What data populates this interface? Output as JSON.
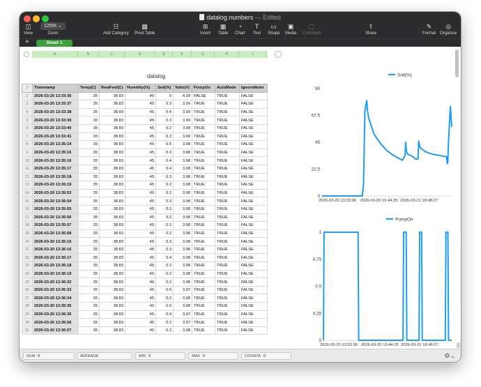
{
  "window": {
    "doc_name": "datalog.numbers",
    "doc_status": "— Edited"
  },
  "toolbar": {
    "view": "View",
    "zoom_value": "125%",
    "zoom": "Zoom",
    "add_category": "Add Category",
    "pivot_table": "Pivot Table",
    "insert": "Insert",
    "table": "Table",
    "chart": "Chart",
    "text": "Text",
    "shape": "Shape",
    "media": "Media",
    "comment": "Comment",
    "share": "Share",
    "format": "Format",
    "organise": "Organise"
  },
  "sheet_tab": "Sheet 1",
  "columns": [
    "A",
    "B",
    "C",
    "D",
    "E",
    "F",
    "G",
    "H",
    "I"
  ],
  "table": {
    "title": "datalog",
    "headers": [
      "Timestamp",
      "Temp(C)",
      "RealFeel(C)",
      "Humidity(%)",
      "Soil(%)",
      "Volts(V)",
      "PumpOn",
      "AutoMode",
      "IgnoreMoist"
    ],
    "header_row_number": "1",
    "rows": [
      [
        "2",
        "2026-03-20 13:33:36",
        "35",
        "38.83",
        "45",
        "0",
        "4.09",
        "FALSE",
        "TRUE",
        "FALSE"
      ],
      [
        "3",
        "2026-03-20 13:33:37",
        "35",
        "38.83",
        "45",
        "0.3",
        "3.99",
        "TRUE",
        "TRUE",
        "FALSE"
      ],
      [
        "4",
        "2026-03-20 13:33:38",
        "35",
        "38.83",
        "45",
        "0.4",
        "3.99",
        "TRUE",
        "TRUE",
        "FALSE"
      ],
      [
        "5",
        "2026-03-20 13:33:39",
        "35",
        "38.83",
        "45",
        "0.3",
        "3.99",
        "TRUE",
        "TRUE",
        "FALSE"
      ],
      [
        "6",
        "2026-03-20 13:33:40",
        "35",
        "38.83",
        "45",
        "0.2",
        "3.98",
        "TRUE",
        "TRUE",
        "FALSE"
      ],
      [
        "7",
        "2026-03-20 13:33:41",
        "35",
        "38.83",
        "45",
        "0.3",
        "3.99",
        "TRUE",
        "TRUE",
        "FALSE"
      ],
      [
        "8",
        "2026-03-20 13:35:14",
        "35",
        "38.83",
        "45",
        "0.5",
        "3.98",
        "TRUE",
        "TRUE",
        "FALSE"
      ],
      [
        "9",
        "2026-03-20 13:35:15",
        "35",
        "38.83",
        "45",
        "0.3",
        "3.98",
        "TRUE",
        "TRUE",
        "FALSE"
      ],
      [
        "10",
        "2026-03-20 13:35:16",
        "35",
        "38.83",
        "45",
        "0.4",
        "3.98",
        "TRUE",
        "TRUE",
        "FALSE"
      ],
      [
        "11",
        "2026-03-20 13:35:17",
        "35",
        "38.83",
        "45",
        "0.4",
        "3.98",
        "TRUE",
        "TRUE",
        "FALSE"
      ],
      [
        "12",
        "2026-03-20 13:35:18",
        "35",
        "38.83",
        "45",
        "0.3",
        "3.98",
        "TRUE",
        "TRUE",
        "FALSE"
      ],
      [
        "13",
        "2026-03-20 13:35:19",
        "35",
        "38.83",
        "45",
        "0.2",
        "3.98",
        "TRUE",
        "TRUE",
        "FALSE"
      ],
      [
        "14",
        "2026-03-20 13:35:53",
        "35",
        "38.83",
        "45",
        "0.2",
        "3.98",
        "TRUE",
        "TRUE",
        "FALSE"
      ],
      [
        "15",
        "2026-03-20 13:35:54",
        "35",
        "38.83",
        "45",
        "0.3",
        "3.98",
        "TRUE",
        "TRUE",
        "FALSE"
      ],
      [
        "16",
        "2026-03-20 13:35:55",
        "35",
        "38.83",
        "45",
        "0.2",
        "3.98",
        "TRUE",
        "TRUE",
        "FALSE"
      ],
      [
        "17",
        "2026-03-20 13:35:56",
        "35",
        "38.83",
        "45",
        "0.2",
        "3.98",
        "TRUE",
        "TRUE",
        "FALSE"
      ],
      [
        "18",
        "2026-03-20 13:35:57",
        "35",
        "38.83",
        "45",
        "0.2",
        "3.98",
        "TRUE",
        "TRUE",
        "FALSE"
      ],
      [
        "19",
        "2026-03-20 13:35:58",
        "35",
        "38.83",
        "45",
        "0.2",
        "3.98",
        "TRUE",
        "TRUE",
        "FALSE"
      ],
      [
        "20",
        "2026-03-20 13:36:15",
        "35",
        "38.83",
        "45",
        "0.3",
        "3.98",
        "TRUE",
        "TRUE",
        "FALSE"
      ],
      [
        "21",
        "2026-03-20 13:36:16",
        "35",
        "38.83",
        "45",
        "0.3",
        "3.98",
        "TRUE",
        "TRUE",
        "FALSE"
      ],
      [
        "22",
        "2026-03-20 13:36:17",
        "35",
        "38.83",
        "45",
        "0.4",
        "3.98",
        "TRUE",
        "TRUE",
        "FALSE"
      ],
      [
        "23",
        "2026-03-20 13:36:18",
        "35",
        "38.83",
        "45",
        "0.2",
        "3.98",
        "TRUE",
        "TRUE",
        "FALSE"
      ],
      [
        "24",
        "2026-03-20 13:36:19",
        "35",
        "38.83",
        "45",
        "0.2",
        "3.98",
        "TRUE",
        "TRUE",
        "FALSE"
      ],
      [
        "25",
        "2026-03-20 13:36:32",
        "35",
        "38.83",
        "45",
        "0.2",
        "3.98",
        "TRUE",
        "TRUE",
        "FALSE"
      ],
      [
        "26",
        "2026-03-20 13:36:33",
        "35",
        "38.83",
        "45",
        "0.5",
        "3.97",
        "TRUE",
        "TRUE",
        "FALSE"
      ],
      [
        "27",
        "2026-03-20 13:36:34",
        "35",
        "38.83",
        "45",
        "0.2",
        "3.98",
        "TRUE",
        "TRUE",
        "FALSE"
      ],
      [
        "28",
        "2026-03-20 13:36:35",
        "35",
        "38.83",
        "45",
        "0.6",
        "3.98",
        "TRUE",
        "TRUE",
        "FALSE"
      ],
      [
        "29",
        "2026-03-20 13:36:36",
        "35",
        "38.83",
        "45",
        "0.4",
        "3.97",
        "TRUE",
        "TRUE",
        "FALSE"
      ],
      [
        "30",
        "2026-03-20 13:36:56",
        "35",
        "38.83",
        "45",
        "0.2",
        "3.97",
        "TRUE",
        "TRUE",
        "FALSE"
      ],
      [
        "31",
        "2026-03-20 13:36:57",
        "35",
        "38.83",
        "45",
        "0.2",
        "3.98",
        "TRUE",
        "TRUE",
        "FALSE"
      ]
    ]
  },
  "status_bar": {
    "sum_label": "SUM",
    "sum_value": "0",
    "average_label": "AVERAGE",
    "average_value": "",
    "min_label": "MIN",
    "min_value": "0",
    "max_label": "MAX",
    "max_value": "0",
    "counta_label": "COUNTA",
    "counta_value": "0"
  },
  "chart_data": [
    {
      "type": "line",
      "color": "#1e9cf0",
      "legend_position": "top",
      "series": [
        {
          "name": "Soil(%)"
        }
      ],
      "ylim": [
        0,
        90
      ],
      "y_ticks": [
        "0",
        "22.5",
        "45",
        "67.5",
        "90"
      ],
      "x_ticks": [
        "2026-03-20 13:33:36",
        "2026-03-20 15:44:25",
        "2026-03-21 18:48:27"
      ],
      "x": [
        0,
        0.31,
        0.32,
        0.33,
        0.335,
        0.34,
        0.345,
        0.35,
        0.36,
        0.4,
        0.45,
        0.5,
        0.55,
        0.6,
        0.62,
        0.64,
        0.645,
        0.65,
        0.66,
        0.7,
        0.72,
        0.74,
        0.745,
        0.75,
        0.76,
        0.8,
        0.85,
        0.9,
        0.95,
        0.96,
        0.965,
        0.97,
        0.975,
        0.99,
        1.0
      ],
      "y": [
        0,
        0,
        10,
        70,
        75,
        77,
        80,
        72,
        65,
        52,
        44,
        38,
        34,
        31,
        30,
        34,
        45,
        38,
        35,
        33,
        31,
        31,
        46,
        43,
        40,
        37,
        35,
        34,
        33,
        33,
        27,
        28,
        45,
        75,
        58
      ]
    },
    {
      "type": "line",
      "color": "#1e9cf0",
      "legend_position": "top",
      "series": [
        {
          "name": "PumpOn"
        }
      ],
      "ylim": [
        0,
        1
      ],
      "y_ticks": [
        "0",
        "0.25",
        "0.5",
        "0.75",
        "1"
      ],
      "x_ticks": [
        "2026-03-20 13:33:36",
        "2026-03-20 15:44:25",
        "2026-03-21 18:48:27"
      ],
      "x": [
        0,
        0.005,
        0.27,
        0.275,
        0.62,
        0.625,
        0.645,
        0.65,
        0.745,
        0.75,
        0.765,
        0.77,
        0.95,
        0.955,
        0.97,
        0.975,
        1.0
      ],
      "y": [
        0,
        1,
        1,
        0,
        0,
        1,
        1,
        0,
        0,
        1,
        1,
        0,
        0,
        1,
        1,
        0,
        0
      ]
    }
  ]
}
